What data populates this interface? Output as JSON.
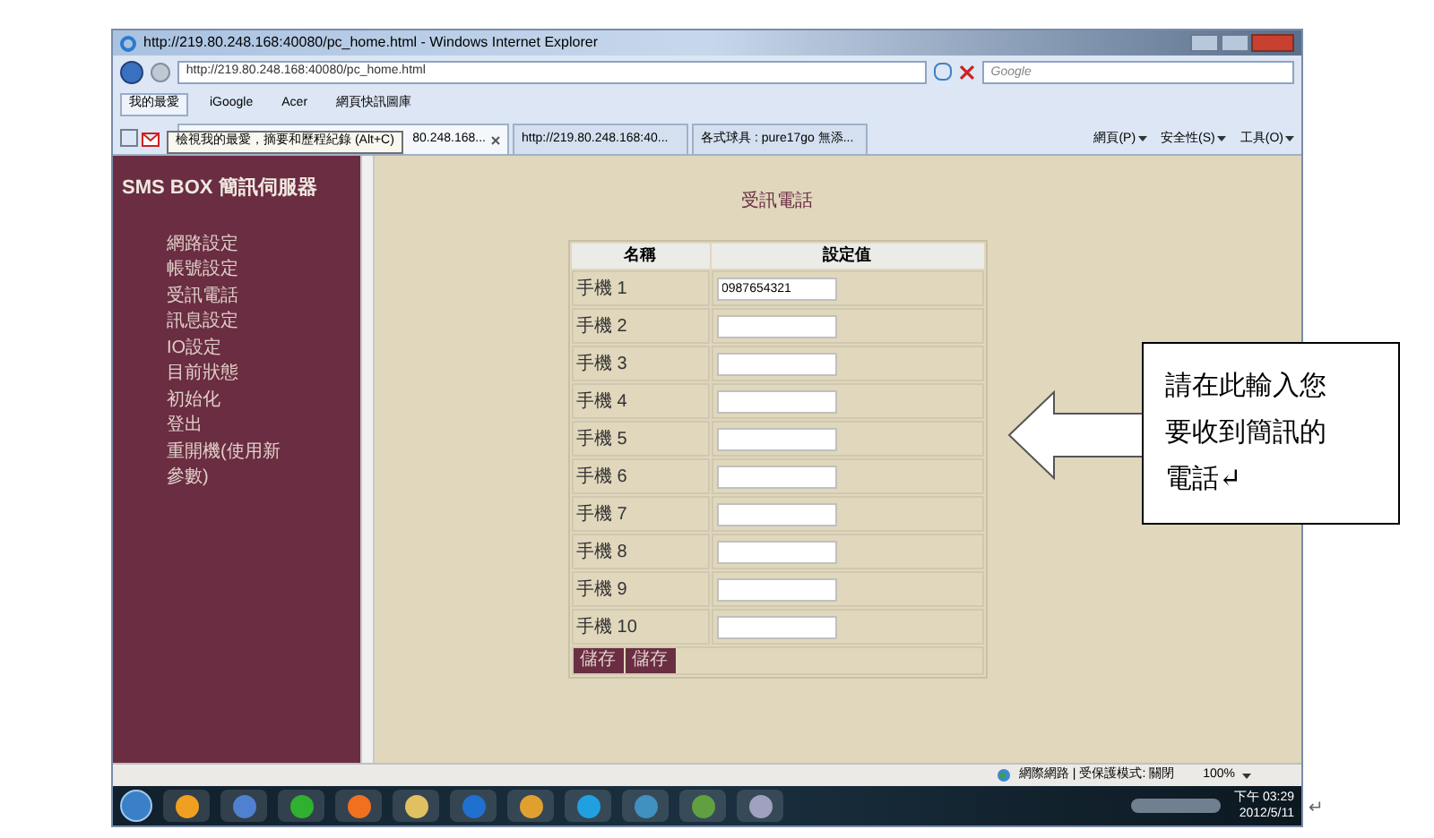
{
  "window": {
    "title": "http://219.80.248.168:40080/pc_home.html - Windows Internet Explorer"
  },
  "address_bar": {
    "value": "http://219.80.248.168:40080/pc_home.html"
  },
  "search": {
    "placeholder": "Google"
  },
  "favorites_bar": {
    "items": [
      {
        "label": "我的最愛"
      },
      {
        "label": "iGoogle"
      },
      {
        "label": "Acer"
      },
      {
        "label": "網頁快訊圖庫"
      }
    ]
  },
  "tabs": [
    {
      "label": "80.248.168...",
      "selected": true
    },
    {
      "label": "http://219.80.248.168:40...",
      "selected": false
    },
    {
      "label": "各式球具 : pure17go 無添...",
      "selected": false
    }
  ],
  "tooltip": "檢視我的最愛，摘要和歷程紀錄 (Alt+C)",
  "command_bar": [
    "網頁(P)",
    "安全性(S)",
    "工具(O)"
  ],
  "sidebar": {
    "title": "SMS BOX 簡訊伺服器",
    "items": [
      {
        "label": "網路設定"
      },
      {
        "label": "帳號設定"
      },
      {
        "label": "受訊電話"
      },
      {
        "label": "訊息設定"
      },
      {
        "label": "IO設定"
      },
      {
        "label": "目前狀態"
      },
      {
        "label": "初始化"
      },
      {
        "label": "登出"
      },
      {
        "label": "重開機(使用新參數)"
      }
    ]
  },
  "page": {
    "title": "受訊電話",
    "table": {
      "columns": [
        "名稱",
        "設定值"
      ],
      "rows": [
        {
          "name": "手機 1",
          "value": "0987654321"
        },
        {
          "name": "手機 2"
        },
        {
          "name": "手機 3"
        },
        {
          "name": "手機 4"
        },
        {
          "name": "手機 5"
        },
        {
          "name": "手機 6"
        },
        {
          "name": "手機 7"
        },
        {
          "name": "手機 8"
        },
        {
          "name": "手機 9"
        },
        {
          "name": "手機 10"
        }
      ]
    },
    "buttons": [
      "儲存",
      "儲存"
    ]
  },
  "status_bar": {
    "zone": "網際網路 | 受保護模式: 關閉",
    "zoom": "100%"
  },
  "taskbar": {
    "time": "下午 03:29",
    "date": "2012/5/11"
  },
  "callout": {
    "text": "請在此輸入您要收到簡訊的電話↵"
  },
  "paragraph_mark": "↵"
}
